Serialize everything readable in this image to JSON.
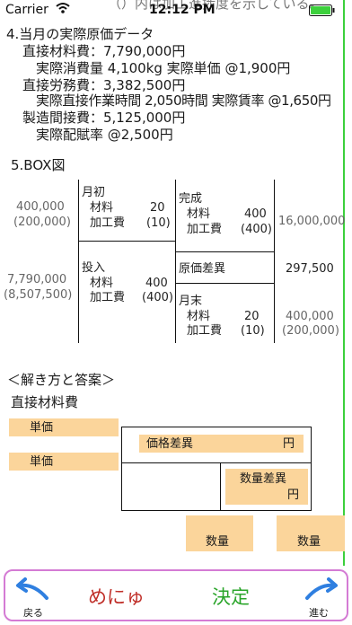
{
  "status": {
    "carrier": "Carrier",
    "time": "12:12 PM",
    "partial_text": "（）内は加工進捗度を示している。"
  },
  "section4": {
    "title": "4.当月の実際原価データ",
    "material_cost": "直接材料費：7,790,000円",
    "material_detail": "実際消費量 4,100kg 実際単価 @1,900円",
    "labor_cost": "直接労務費：3,382,500円",
    "labor_detail": "実際直接作業時間 2,050時間 実際賃率 @1,650円",
    "overhead_cost": "製造間接費：5,125,000円",
    "overhead_detail": "実際配賦率 @2,500円"
  },
  "box": {
    "title": "5.BOX図",
    "left_top_amount": "400,000",
    "left_top_paren": "(200,000)",
    "left_bottom_amount": "7,790,000",
    "left_bottom_paren": "(8,507,500)",
    "begin_label": "月初",
    "begin_material_label": "材料",
    "begin_material_value": "20",
    "begin_process_label": "加工費",
    "begin_process_value": "(10)",
    "input_label": "投入",
    "input_material_label": "材料",
    "input_material_value": "400",
    "input_process_label": "加工費",
    "input_process_value": "(400)",
    "done_label": "完成",
    "done_material_label": "材料",
    "done_material_value": "400",
    "done_process_label": "加工費",
    "done_process_value": "(400)",
    "done_amount": "16,000,000",
    "variance_label": "原価差異",
    "variance_amount": "297,500",
    "end_label": "月末",
    "end_material_label": "材料",
    "end_material_value": "20",
    "end_process_label": "加工費",
    "end_process_value": "(10)",
    "end_amount": "400,000",
    "end_paren": "(200,000)"
  },
  "solution": {
    "heading": "＜解き方と答案＞",
    "subheading": "直接材料費",
    "unit_price_1": "単価",
    "unit_price_2": "単価",
    "price_variance": "価格差異",
    "price_variance_unit": "円",
    "quantity_variance": "数量差異",
    "quantity_variance_unit": "円",
    "quantity_1": "数量",
    "quantity_2": "数量"
  },
  "bottom": {
    "back_label": "戻る",
    "menu_label": "めにゅ",
    "decide_label": "決定",
    "next_label": "進む"
  },
  "colors": {
    "accent_green": "#3cd03c",
    "peach": "#fbd59b",
    "frame": "#d47bd4",
    "arrow_blue": "#2f7fe0",
    "menu_red": "#c0302a",
    "decide_green": "#2aa52a"
  }
}
